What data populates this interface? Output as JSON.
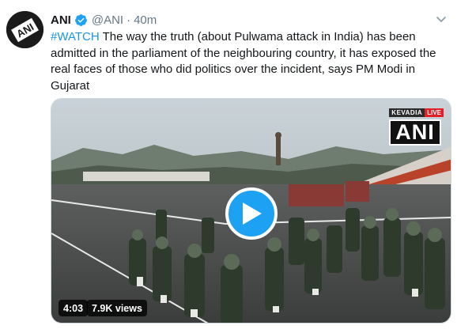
{
  "tweet": {
    "author_name": "ANI",
    "handle": "@ANI",
    "separator": "·",
    "time": "40m",
    "avatar_text": "ANI",
    "hashtag": "#WATCH",
    "text": " The way the truth (about Pulwama attack in India) has been admitted in the parliament of the neighbouring country, it has exposed the real faces of those who did politics over the incident, says PM Modi in Gujarat"
  },
  "video": {
    "location_tag": "KEVADIA",
    "live_tag": "LIVE",
    "watermark": "ANI",
    "duration": "4:03",
    "views": "7.9K views"
  },
  "icons": {
    "verified": "verified-badge-icon",
    "more": "chevron-down-icon",
    "play": "play-icon"
  },
  "colors": {
    "accent": "#1da1f2",
    "hashtag": "#1b95e0",
    "muted": "#657786"
  }
}
